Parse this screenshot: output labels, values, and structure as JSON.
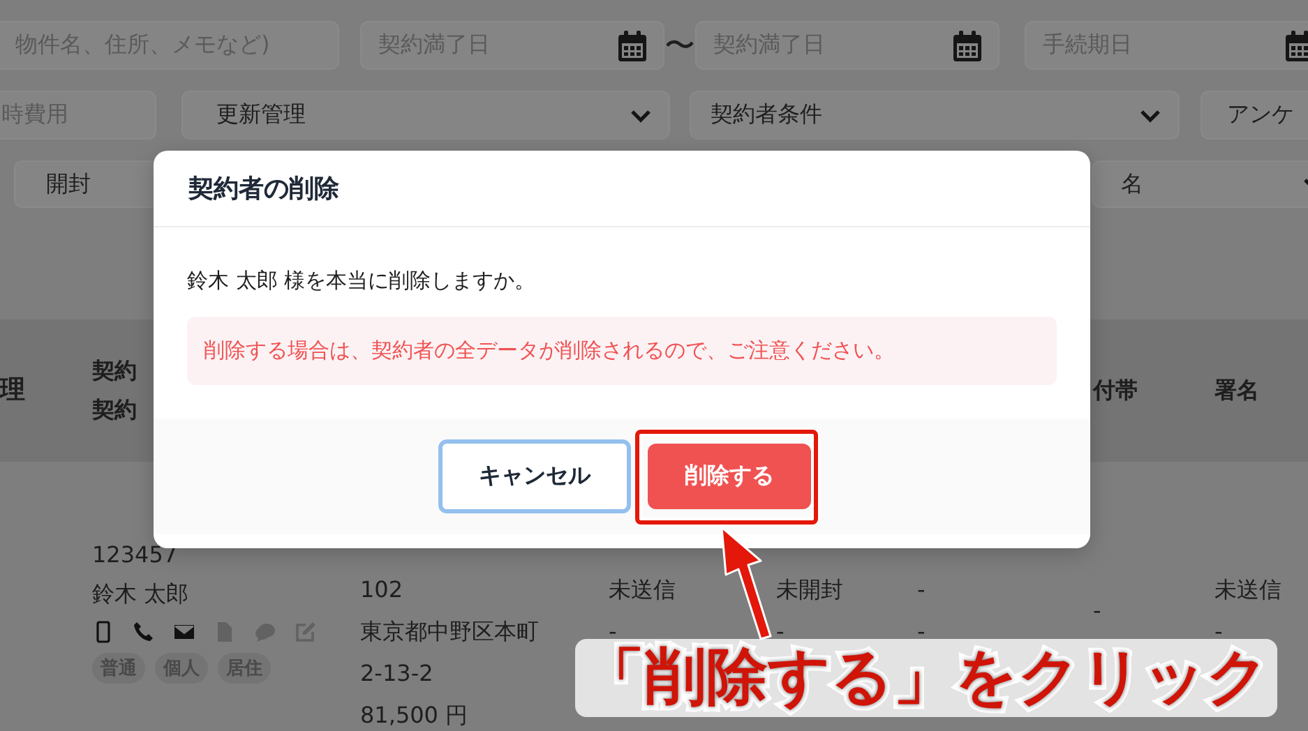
{
  "filters": {
    "row_1": [
      {
        "kind": "input",
        "placeholder": "物件名、住所、メモなど)"
      },
      {
        "kind": "date",
        "placeholder": "契約満了日"
      },
      {
        "kind": "separator",
        "label": "〜"
      },
      {
        "kind": "date",
        "placeholder": "契約満了日"
      },
      {
        "kind": "date",
        "placeholder": "手続期日"
      }
    ],
    "row_2": [
      {
        "kind": "input",
        "placeholder": "時費用"
      },
      {
        "kind": "select",
        "label": "更新管理"
      },
      {
        "kind": "select",
        "label": "契約者条件"
      },
      {
        "kind": "plain",
        "label": "アンケ"
      }
    ],
    "row_3": [
      {
        "kind": "plain",
        "label": "開封"
      },
      {
        "kind": "select",
        "label": "名"
      }
    ]
  },
  "table": {
    "columns": [
      {
        "lines": [
          "理"
        ]
      },
      {
        "lines": [
          "契約",
          "契約"
        ]
      },
      {
        "lines": [
          "付帯"
        ]
      },
      {
        "lines": [
          "署名"
        ]
      }
    ],
    "row": {
      "id": "123457",
      "name": "鈴木 太郎",
      "contacts": [
        {
          "kind": "mobile",
          "enabled": true
        },
        {
          "kind": "phone",
          "enabled": true
        },
        {
          "kind": "mail",
          "enabled": true
        },
        {
          "kind": "document",
          "enabled": false
        },
        {
          "kind": "chat",
          "enabled": false
        },
        {
          "kind": "edit",
          "enabled": false
        }
      ],
      "tags": [
        "普通",
        "個人",
        "居住"
      ],
      "address": [
        "102",
        "東京都中野区本町",
        "2-13-2",
        "81,500 円"
      ],
      "statuses": [
        [
          "未送信",
          "-"
        ],
        [
          "未開封",
          "-"
        ],
        [
          "-",
          "-"
        ],
        [
          "-"
        ],
        [
          "未送信",
          "-"
        ]
      ]
    }
  },
  "dialog": {
    "title": "契約者の削除",
    "message": "鈴木 太郎 様を本当に削除しますか。",
    "warning": "削除する場合は、契約者の全データが削除されるので、ご注意ください。",
    "cancel": "キャンセル",
    "confirm": "削除する"
  },
  "annotation": {
    "caption": "「削除する」をクリック"
  }
}
